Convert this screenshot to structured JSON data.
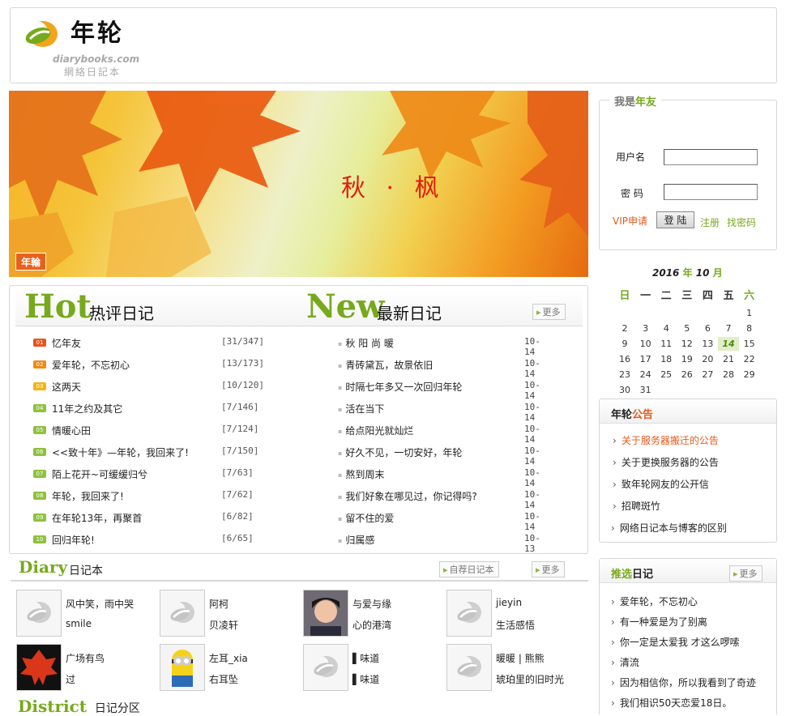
{
  "header": {
    "logo_cn": "年轮",
    "logo_en": "diarybooks.com",
    "logo_sub": "網絡日記本"
  },
  "banner": {
    "title": "秋 · 枫",
    "badge": "年輪"
  },
  "hot": {
    "title_en": "Hot",
    "title_cn": "热评日记",
    "items": [
      {
        "num": "01",
        "title": "忆年友",
        "count": "[31/347]"
      },
      {
        "num": "02",
        "title": "爱年轮，不忘初心",
        "count": "[13/173]"
      },
      {
        "num": "03",
        "title": "这两天",
        "count": "[10/120]"
      },
      {
        "num": "04",
        "title": "11年之约及其它",
        "count": "[7/146]"
      },
      {
        "num": "05",
        "title": "情暖心田",
        "count": "[7/124]"
      },
      {
        "num": "06",
        "title": "<<致十年》—年轮，我回来了!",
        "count": "[7/150]"
      },
      {
        "num": "07",
        "title": "陌上花开~可缓缓归兮",
        "count": "[7/63]"
      },
      {
        "num": "08",
        "title": "年轮，我回来了!",
        "count": "[7/62]"
      },
      {
        "num": "09",
        "title": "在年轮13年，再聚首",
        "count": "[6/82]"
      },
      {
        "num": "10",
        "title": "回归年轮!",
        "count": "[6/65]"
      }
    ]
  },
  "new": {
    "title_en": "New",
    "title_cn": "最新日记",
    "more": "更多",
    "items": [
      {
        "title": "秋 阳 尚 暖",
        "date": "10-14"
      },
      {
        "title": "青砖黛瓦，故景依旧",
        "date": "10-14"
      },
      {
        "title": "时隔七年多又一次回归年轮",
        "date": "10-14"
      },
      {
        "title": "活在当下",
        "date": "10-14"
      },
      {
        "title": "给点阳光就灿烂",
        "date": "10-14"
      },
      {
        "title": "好久不见，一切安好，年轮",
        "date": "10-14"
      },
      {
        "title": "熬到周末",
        "date": "10-14"
      },
      {
        "title": "我们好象在哪见过，你记得吗?",
        "date": "10-14"
      },
      {
        "title": "留不住的爱",
        "date": "10-14"
      },
      {
        "title": "归属感",
        "date": "10-13"
      }
    ]
  },
  "diary": {
    "title_en": "Diary",
    "title_cn": "日记本",
    "recommend": "自荐日记本",
    "more": "更多",
    "books": [
      {
        "user": "风中笑，雨中哭",
        "book": "smile",
        "avatar": "default"
      },
      {
        "user": "阿柯",
        "book": "贝凌轩",
        "avatar": "default"
      },
      {
        "user": "与爱与缘",
        "book": "心的港湾",
        "avatar": "girl"
      },
      {
        "user": "jieyin",
        "book": "生活感悟",
        "avatar": "default"
      },
      {
        "user": "广场有鸟",
        "book": "过",
        "avatar": "leaf"
      },
      {
        "user": "左耳_xia",
        "book": "右耳坠",
        "avatar": "minion"
      },
      {
        "user": "▌味道",
        "book": "▌味道",
        "avatar": "default"
      },
      {
        "user": "暖暖 | 熊熊",
        "book": "琥珀里的旧时光",
        "avatar": "default"
      }
    ]
  },
  "district": {
    "title_en": "District",
    "title_cn": "日记分区"
  },
  "login": {
    "legend_a": "我是",
    "legend_b": "年友",
    "username_label": "用户名",
    "password_label": "密 码",
    "vip": "VIP申请",
    "login_btn": "登 陆",
    "register": "注册",
    "forgot": "找密码"
  },
  "calendar": {
    "year": "2016",
    "year_unit": "年",
    "month": "10",
    "month_unit": "月",
    "weekdays": [
      "日",
      "一",
      "二",
      "三",
      "四",
      "五",
      "六"
    ],
    "days": [
      "1",
      "2",
      "3",
      "4",
      "5",
      "6",
      "7",
      "8",
      "9",
      "10",
      "11",
      "12",
      "13",
      "14",
      "15",
      "16",
      "17",
      "18",
      "19",
      "20",
      "21",
      "22",
      "23",
      "24",
      "25",
      "26",
      "27",
      "28",
      "29",
      "30",
      "31"
    ],
    "today": "14"
  },
  "notice": {
    "title_a": "年轮",
    "title_b": "公告",
    "items": [
      "关于服务器搬迁的公告",
      "关于更换服务器的公告",
      "致年轮网友的公开信",
      "招聘斑竹",
      "网络日记本与博客的区别"
    ]
  },
  "picks": {
    "title_a": "推选",
    "title_b": "日记",
    "more": "更多",
    "items": [
      "爱年轮，不忘初心",
      "有一种爱是为了别离",
      "你一定是太爱我 才这么啰嗦",
      "清流",
      "因为相信你，所以我看到了奇迹",
      "我们相识50天恋爱18日。"
    ]
  },
  "colors": {
    "accent": "#76a91c",
    "orange": "#e45a1b",
    "red": "#e11d0f",
    "num_badges": [
      "#e8541d",
      "#f08a16",
      "#f2b418",
      "#8fc13e",
      "#8fc13e",
      "#8fc13e",
      "#8fc13e",
      "#8fc13e",
      "#8fc13e",
      "#8fc13e"
    ]
  }
}
